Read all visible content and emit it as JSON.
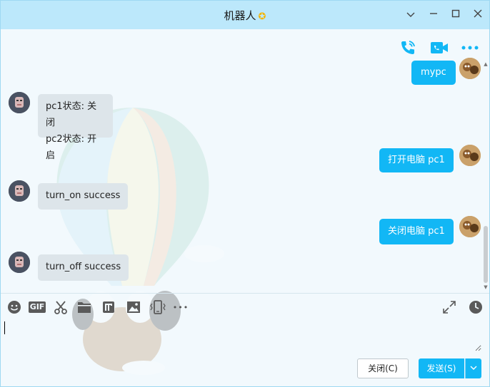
{
  "window": {
    "title": "机器人",
    "title_star_icon": "star-badge-icon",
    "controls": [
      "chevron-down-icon",
      "minimize-icon",
      "maximize-icon",
      "close-icon"
    ]
  },
  "header_tools": [
    "voice-call-icon",
    "video-call-icon",
    "more-icon"
  ],
  "messages": [
    {
      "side": "out",
      "text": "mypc"
    },
    {
      "side": "in",
      "lines": [
        "pc1状态: 关闭",
        "pc2状态: 开启"
      ]
    },
    {
      "side": "out",
      "text": "打开电脑 pc1"
    },
    {
      "side": "in",
      "text": "turn_on success"
    },
    {
      "side": "out",
      "text": "关闭电脑 pc1"
    },
    {
      "side": "in",
      "text": "turn_off success"
    }
  ],
  "toolbar": {
    "gif_label": "GIF",
    "more_glyph": "•••",
    "left_tools": [
      "emoji-icon",
      "gif-icon",
      "scissors-icon",
      "folder-icon",
      "font-icon",
      "image-icon",
      "shake-icon",
      "more-icon"
    ],
    "right_tools": [
      "expand-icon",
      "history-clock-icon"
    ]
  },
  "input": {
    "value": "",
    "placeholder": ""
  },
  "buttons": {
    "close_label": "关闭(C)",
    "send_label": "发送(S)"
  },
  "colors": {
    "accent": "#12b7f5",
    "titlebar": "#bce8fb",
    "incoming_bubble": "#dde5ea"
  }
}
